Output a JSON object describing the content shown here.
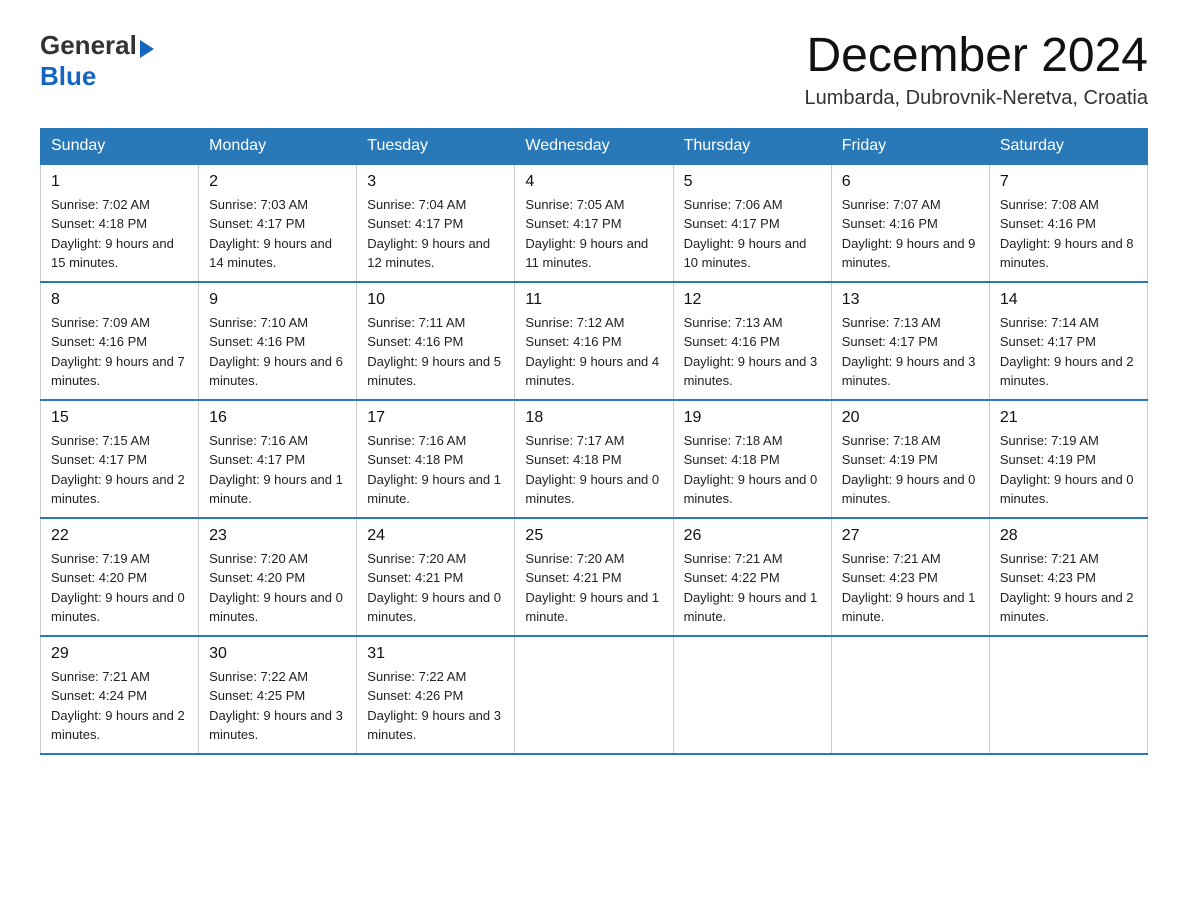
{
  "header": {
    "logo_general": "General",
    "logo_blue": "Blue",
    "month_title": "December 2024",
    "location": "Lumbarda, Dubrovnik-Neretva, Croatia"
  },
  "days_of_week": [
    "Sunday",
    "Monday",
    "Tuesday",
    "Wednesday",
    "Thursday",
    "Friday",
    "Saturday"
  ],
  "weeks": [
    [
      {
        "day": "1",
        "sunrise": "7:02 AM",
        "sunset": "4:18 PM",
        "daylight": "9 hours and 15 minutes."
      },
      {
        "day": "2",
        "sunrise": "7:03 AM",
        "sunset": "4:17 PM",
        "daylight": "9 hours and 14 minutes."
      },
      {
        "day": "3",
        "sunrise": "7:04 AM",
        "sunset": "4:17 PM",
        "daylight": "9 hours and 12 minutes."
      },
      {
        "day": "4",
        "sunrise": "7:05 AM",
        "sunset": "4:17 PM",
        "daylight": "9 hours and 11 minutes."
      },
      {
        "day": "5",
        "sunrise": "7:06 AM",
        "sunset": "4:17 PM",
        "daylight": "9 hours and 10 minutes."
      },
      {
        "day": "6",
        "sunrise": "7:07 AM",
        "sunset": "4:16 PM",
        "daylight": "9 hours and 9 minutes."
      },
      {
        "day": "7",
        "sunrise": "7:08 AM",
        "sunset": "4:16 PM",
        "daylight": "9 hours and 8 minutes."
      }
    ],
    [
      {
        "day": "8",
        "sunrise": "7:09 AM",
        "sunset": "4:16 PM",
        "daylight": "9 hours and 7 minutes."
      },
      {
        "day": "9",
        "sunrise": "7:10 AM",
        "sunset": "4:16 PM",
        "daylight": "9 hours and 6 minutes."
      },
      {
        "day": "10",
        "sunrise": "7:11 AM",
        "sunset": "4:16 PM",
        "daylight": "9 hours and 5 minutes."
      },
      {
        "day": "11",
        "sunrise": "7:12 AM",
        "sunset": "4:16 PM",
        "daylight": "9 hours and 4 minutes."
      },
      {
        "day": "12",
        "sunrise": "7:13 AM",
        "sunset": "4:16 PM",
        "daylight": "9 hours and 3 minutes."
      },
      {
        "day": "13",
        "sunrise": "7:13 AM",
        "sunset": "4:17 PM",
        "daylight": "9 hours and 3 minutes."
      },
      {
        "day": "14",
        "sunrise": "7:14 AM",
        "sunset": "4:17 PM",
        "daylight": "9 hours and 2 minutes."
      }
    ],
    [
      {
        "day": "15",
        "sunrise": "7:15 AM",
        "sunset": "4:17 PM",
        "daylight": "9 hours and 2 minutes."
      },
      {
        "day": "16",
        "sunrise": "7:16 AM",
        "sunset": "4:17 PM",
        "daylight": "9 hours and 1 minute."
      },
      {
        "day": "17",
        "sunrise": "7:16 AM",
        "sunset": "4:18 PM",
        "daylight": "9 hours and 1 minute."
      },
      {
        "day": "18",
        "sunrise": "7:17 AM",
        "sunset": "4:18 PM",
        "daylight": "9 hours and 0 minutes."
      },
      {
        "day": "19",
        "sunrise": "7:18 AM",
        "sunset": "4:18 PM",
        "daylight": "9 hours and 0 minutes."
      },
      {
        "day": "20",
        "sunrise": "7:18 AM",
        "sunset": "4:19 PM",
        "daylight": "9 hours and 0 minutes."
      },
      {
        "day": "21",
        "sunrise": "7:19 AM",
        "sunset": "4:19 PM",
        "daylight": "9 hours and 0 minutes."
      }
    ],
    [
      {
        "day": "22",
        "sunrise": "7:19 AM",
        "sunset": "4:20 PM",
        "daylight": "9 hours and 0 minutes."
      },
      {
        "day": "23",
        "sunrise": "7:20 AM",
        "sunset": "4:20 PM",
        "daylight": "9 hours and 0 minutes."
      },
      {
        "day": "24",
        "sunrise": "7:20 AM",
        "sunset": "4:21 PM",
        "daylight": "9 hours and 0 minutes."
      },
      {
        "day": "25",
        "sunrise": "7:20 AM",
        "sunset": "4:21 PM",
        "daylight": "9 hours and 1 minute."
      },
      {
        "day": "26",
        "sunrise": "7:21 AM",
        "sunset": "4:22 PM",
        "daylight": "9 hours and 1 minute."
      },
      {
        "day": "27",
        "sunrise": "7:21 AM",
        "sunset": "4:23 PM",
        "daylight": "9 hours and 1 minute."
      },
      {
        "day": "28",
        "sunrise": "7:21 AM",
        "sunset": "4:23 PM",
        "daylight": "9 hours and 2 minutes."
      }
    ],
    [
      {
        "day": "29",
        "sunrise": "7:21 AM",
        "sunset": "4:24 PM",
        "daylight": "9 hours and 2 minutes."
      },
      {
        "day": "30",
        "sunrise": "7:22 AM",
        "sunset": "4:25 PM",
        "daylight": "9 hours and 3 minutes."
      },
      {
        "day": "31",
        "sunrise": "7:22 AM",
        "sunset": "4:26 PM",
        "daylight": "9 hours and 3 minutes."
      },
      null,
      null,
      null,
      null
    ]
  ]
}
